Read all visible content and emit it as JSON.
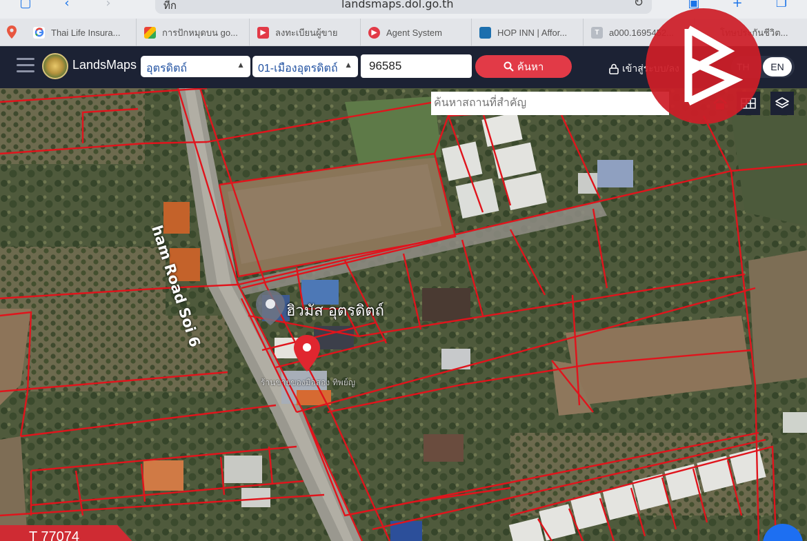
{
  "browser": {
    "url_prefix": "ที่ก",
    "url": "landsmaps.dol.go.th",
    "tabs": [
      {
        "title": "Thai Life Insura...",
        "favicon": "google",
        "color": "#ffffff"
      },
      {
        "title": "การปักหมุดบน go...",
        "favicon": "multicolor",
        "color": "#e0522f"
      },
      {
        "title": "ลงทะเบียนผู้ขาย",
        "favicon": "brand-b",
        "color": "#e23a47"
      },
      {
        "title": "Agent System",
        "favicon": "brand-b",
        "color": "#e23a47"
      },
      {
        "title": "HOP INN | Affor...",
        "favicon": "hotel",
        "color": "#1c6fae"
      },
      {
        "title": "a000.1695452...",
        "favicon": "letter-t",
        "color": "#b7bcc4"
      },
      {
        "title": "โทษประกันชีวิต...",
        "favicon": "page",
        "color": "#d8d8d8"
      }
    ]
  },
  "header": {
    "app_name": "LandsMaps",
    "province": "อุตรดิตถ์",
    "district": "01-เมืองอุตรดิตถ์",
    "parcel_number": "96585",
    "search_label": "ค้นหา",
    "login_label": "เข้าสู่ระบบ/ลง",
    "lang_th": "TH",
    "lang_en": "EN"
  },
  "map": {
    "place_search_placeholder": "ค้นหาสถานที่สำคัญ",
    "road_label": "ham Road Soi 6",
    "poi_label": "ฮิวมัส อุตรดิตถ์",
    "faint_label": "ร้านขายของมือสอง ทิพย์ญ",
    "plot_tag": "T 77074",
    "parcel_line_color": "#e0141c",
    "pin_color": "#e0262f"
  },
  "watermark": {
    "brand": "brand-b-logo",
    "color": "#cd1e28"
  }
}
